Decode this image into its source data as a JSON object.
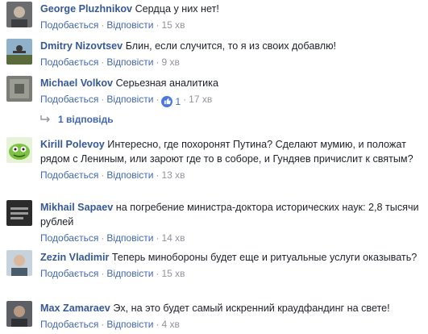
{
  "actions": {
    "like": "Подобається",
    "reply": "Відповісти",
    "dot": "·"
  },
  "comments": [
    {
      "author": "George Pluzhnikov",
      "text": "Сердца у них нет!",
      "time": "15 хв"
    },
    {
      "author": "Dmitry Nizovtsev",
      "text": "Блин, если случится, то я из своих добавлю!",
      "time": "9 хв"
    },
    {
      "author": "Michael Volkov",
      "text": "Серьезная аналитика",
      "time": "17 хв",
      "likes": "1"
    },
    {
      "author": "Kirill Polevoy",
      "text": "Интересно, где похоронят Путина? Сделают мумию, и положат рядом с Лениным, или зароют где то в соборе, и Гундяев причислит к святым?",
      "time": "13 хв"
    },
    {
      "author": "Mikhail Sapaev",
      "text": "на погребение министра-доктора исторических наук: 2,8 тысячи рублей",
      "time": "14 хв"
    },
    {
      "author": "Zezin Vladimir",
      "text": "Теперь минобороны будет еще и ритуальные услуги оказывать?",
      "time": "15 хв"
    },
    {
      "author": "Max Zamaraev",
      "text": "Эх, на это будет самый искренний краудфандинг на свете!",
      "time": "4 хв"
    }
  ],
  "replies_link": "1 відповідь",
  "colors": {
    "link": "#4267b2",
    "author": "#365899",
    "meta": "#90949c",
    "like_badge": "#4a76e8"
  }
}
